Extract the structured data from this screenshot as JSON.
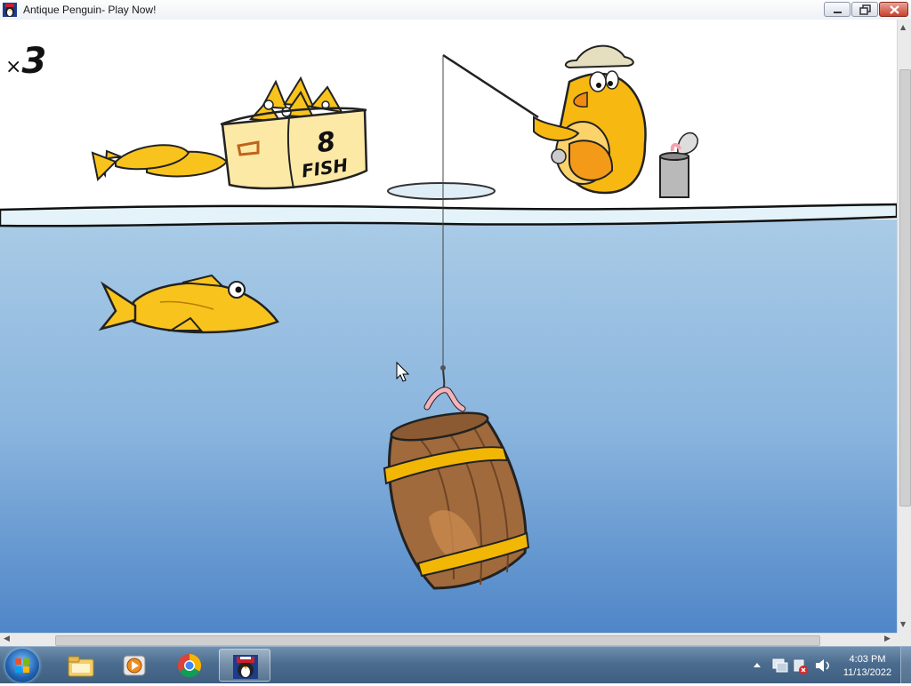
{
  "window": {
    "title": "Antique Penguin- Play Now!"
  },
  "game": {
    "lives_prefix": "×",
    "lives_count": "3",
    "bucket_number": "8",
    "bucket_label": "FISH"
  },
  "taskbar": {
    "items": [
      "start-orb",
      "file-explorer",
      "media-player",
      "chrome",
      "antique-penguin"
    ],
    "active_item": "antique-penguin"
  },
  "clock": {
    "time": "4:03 PM",
    "date": "11/13/2022"
  },
  "colors": {
    "water_top": "#a9cbe6",
    "water_bottom": "#4f86c8",
    "fish": "#f8c31c",
    "penguin": "#f7b812",
    "barrel": "#a06a3c",
    "barrel_band": "#f2b705",
    "ice": "#e3f3f9"
  }
}
